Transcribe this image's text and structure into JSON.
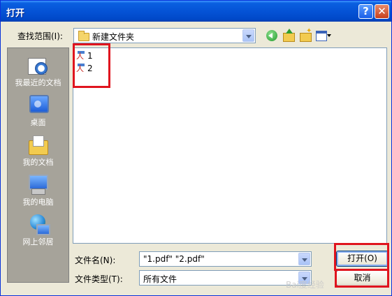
{
  "window": {
    "title": "打开",
    "help_glyph": "?",
    "close_glyph": "✕"
  },
  "toolbar": {
    "look_in_label": "查找范围(I):",
    "look_in_value": "新建文件夹"
  },
  "places": [
    {
      "label": "我最近的文档",
      "icon": "recent-documents-icon"
    },
    {
      "label": "桌面",
      "icon": "desktop-icon"
    },
    {
      "label": "我的文档",
      "icon": "my-documents-icon"
    },
    {
      "label": "我的电脑",
      "icon": "my-computer-icon"
    },
    {
      "label": "网上邻居",
      "icon": "network-places-icon"
    }
  ],
  "files": [
    {
      "name": "1",
      "icon": "pdf-file-icon"
    },
    {
      "name": "2",
      "icon": "pdf-file-icon"
    }
  ],
  "form": {
    "file_name_label": "文件名(N):",
    "file_name_value": "\"1.pdf\" \"2.pdf\"",
    "file_type_label": "文件类型(T):",
    "file_type_value": "所有文件",
    "open_button": "打开(O)",
    "cancel_button": "取消"
  },
  "watermark": "Bai度经验",
  "colors": {
    "title_bar": "#0553d6",
    "highlight": "#e0141e",
    "places_bar": "#a6a39a"
  }
}
